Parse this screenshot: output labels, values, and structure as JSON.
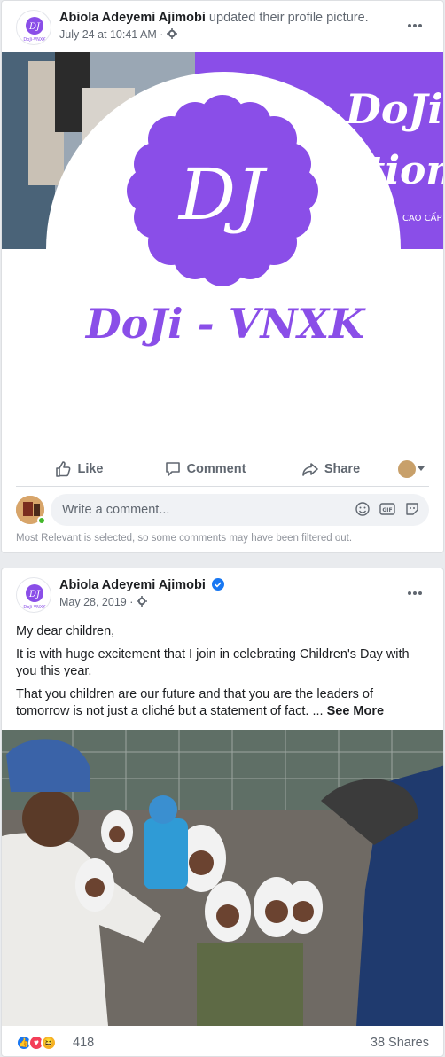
{
  "post1": {
    "author": "Abiola Adeyemi Ajimobi",
    "action": " updated their profile picture.",
    "timestamp": "July 24 at 10:41 AM",
    "logo_monogram": "DJ",
    "logo_wordmark": "DoJi - VNXK",
    "cover_text_1": "DoJi",
    "cover_text_2": "tion",
    "cover_text_3": "CAO CẤP",
    "like_label": "Like",
    "comment_label": "Comment",
    "share_label": "Share",
    "comment_placeholder": "Write a comment...",
    "filter_note": "Most Relevant is selected, so some comments may have been filtered out."
  },
  "post2": {
    "author": "Abiola Adeyemi Ajimobi",
    "timestamp": "May 28, 2019",
    "paragraphs": [
      "My dear children,",
      "It is with huge excitement that I join in celebrating Children's Day with you this year.",
      "That you children are our future and that you are the leaders of tomorrow is not just a cliché but a statement of fact. ... "
    ],
    "see_more": "See More",
    "reaction_count": "418",
    "shares": "38 Shares"
  },
  "colors": {
    "brand_purple": "#8a4ee8",
    "facebook_blue": "#1877f2"
  },
  "icons": [
    "gear-icon",
    "more-icon",
    "like-icon",
    "comment-icon",
    "share-icon",
    "emoji-icon",
    "gif-icon",
    "sticker-icon",
    "verified-icon"
  ]
}
